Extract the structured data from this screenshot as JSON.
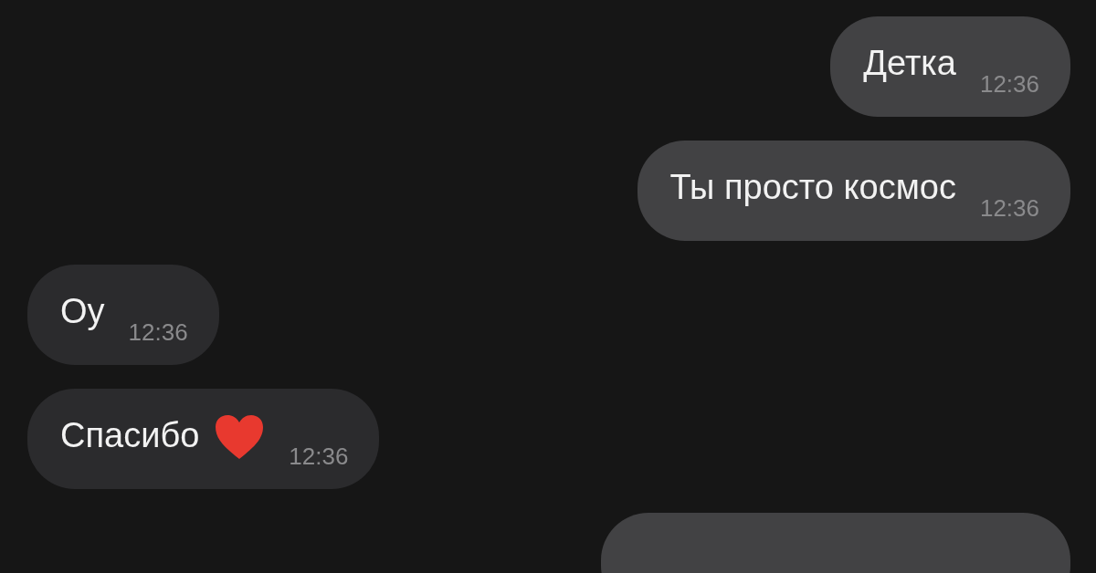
{
  "messages": [
    {
      "kind": "outgoing",
      "text": "Детка",
      "time": "12:36",
      "heart": false
    },
    {
      "kind": "outgoing",
      "text": "Ты просто космос",
      "time": "12:36",
      "heart": false
    },
    {
      "kind": "incoming",
      "text": "Оу",
      "time": "12:36",
      "heart": false
    },
    {
      "kind": "incoming",
      "text": "Спасибо",
      "time": "12:36",
      "heart": true
    },
    {
      "kind": "outgoing"
    }
  ]
}
